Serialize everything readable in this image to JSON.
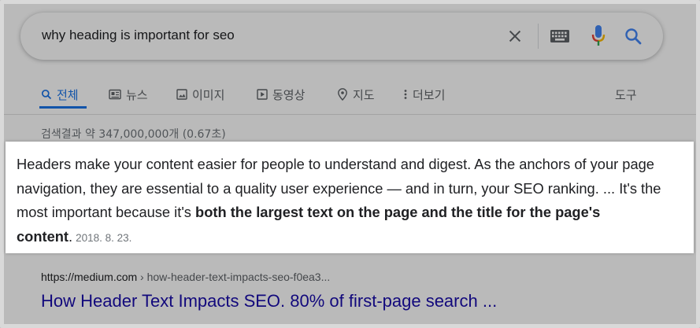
{
  "search": {
    "query": "why heading is important for seo"
  },
  "tabs": [
    {
      "label": "전체",
      "icon": "search-icon",
      "active": true
    },
    {
      "label": "뉴스",
      "icon": "news-icon"
    },
    {
      "label": "이미지",
      "icon": "image-icon"
    },
    {
      "label": "동영상",
      "icon": "video-icon"
    },
    {
      "label": "지도",
      "icon": "map-pin-icon"
    },
    {
      "label": "더보기",
      "icon": "more-vert-icon"
    }
  ],
  "tools_label": "도구",
  "result_stats": "검색결과 약 347,000,000개 (0.67초)",
  "featured_snippet": {
    "text_plain": "Headers make your content easier for people to understand and digest. As the anchors of your page navigation, they are essential to a quality user experience — and in turn, your SEO ranking. ... It's the most important because it's ",
    "text_bold": "both the largest text on the page and the title for the page's content",
    "text_end": ".",
    "date": "2018. 8. 23."
  },
  "result": {
    "domain": "https://medium.com",
    "path": " › how-header-text-impacts-seo-f0ea3...",
    "title": "How Header Text Impacts SEO. 80% of first-page search ..."
  },
  "colors": {
    "accent": "#1a73e8",
    "link": "#1a0dab",
    "mic_blue": "#4285f4",
    "mic_red": "#ea4335",
    "mic_yellow": "#fbbc04",
    "mic_green": "#34a853"
  }
}
